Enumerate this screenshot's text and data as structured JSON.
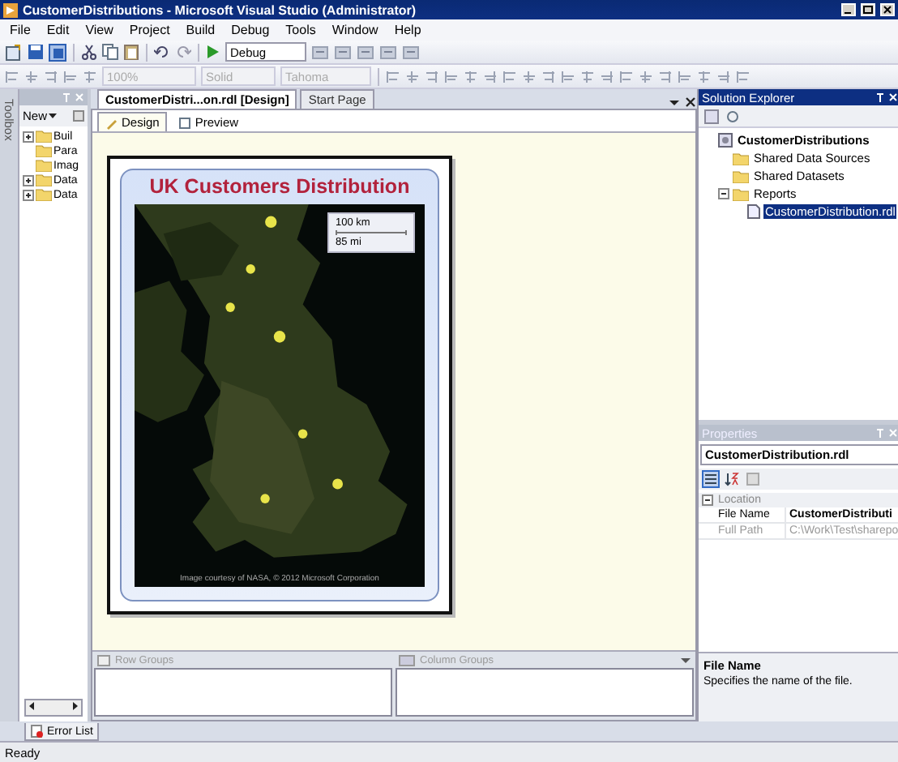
{
  "window": {
    "title": "CustomerDistributions - Microsoft Visual Studio (Administrator)"
  },
  "menu": [
    "File",
    "Edit",
    "View",
    "Project",
    "Build",
    "Debug",
    "Tools",
    "Window",
    "Help"
  ],
  "toolbar": {
    "configuration": "Debug"
  },
  "format_toolbar": {
    "zoom": "100%",
    "line_style": "Solid",
    "font": "Tahoma"
  },
  "toolbox": {
    "label": "Toolbox"
  },
  "report_data": {
    "new_button": "New",
    "items": [
      {
        "label": "Buil",
        "expandable": true
      },
      {
        "label": "Para",
        "expandable": false
      },
      {
        "label": "Imag",
        "expandable": false
      },
      {
        "label": "Data",
        "expandable": true
      },
      {
        "label": "Data",
        "expandable": true
      }
    ]
  },
  "document_tabs": [
    {
      "label": "CustomerDistri...on.rdl [Design]",
      "selected": true
    },
    {
      "label": "Start Page",
      "selected": false
    }
  ],
  "view_tabs": [
    {
      "label": "Design",
      "selected": true
    },
    {
      "label": "Preview",
      "selected": false
    }
  ],
  "report": {
    "title": "UK Customers Distribution",
    "map": {
      "kind": "picture",
      "scale_km": "100 km",
      "scale_mi": "85 mi",
      "attribution": "Image courtesy of NASA, © 2012 Microsoft Corporation"
    }
  },
  "grouping": {
    "row_groups": "Row Groups",
    "column_groups": "Column Groups"
  },
  "solution_explorer": {
    "title": "Solution Explorer",
    "tree": {
      "label": "CustomerDistributions",
      "selected": false,
      "children": [
        {
          "label": "Shared Data Sources",
          "selected": false
        },
        {
          "label": "Shared Datasets",
          "selected": false
        },
        {
          "label": "Reports",
          "selected": false,
          "children": [
            {
              "label": "CustomerDistribution.rdl",
              "selected": true
            }
          ]
        }
      ]
    }
  },
  "properties": {
    "title": "Properties",
    "object": "CustomerDistribution.rdl",
    "view_buttons": [
      {
        "kind": "categorized",
        "selected": true
      },
      {
        "kind": "alphabetical",
        "selected": false
      },
      {
        "kind": "pages",
        "selected": false
      }
    ],
    "category": "Location",
    "rows": [
      {
        "name": "File Name",
        "value": "CustomerDistributi",
        "disabled": false
      },
      {
        "name": "Full Path",
        "value": "C:\\Work\\Test\\sharepo",
        "disabled": true
      }
    ],
    "description": {
      "title": "File Name",
      "text": "Specifies the name of the file."
    }
  },
  "error_list": "Error List",
  "status": "Ready"
}
